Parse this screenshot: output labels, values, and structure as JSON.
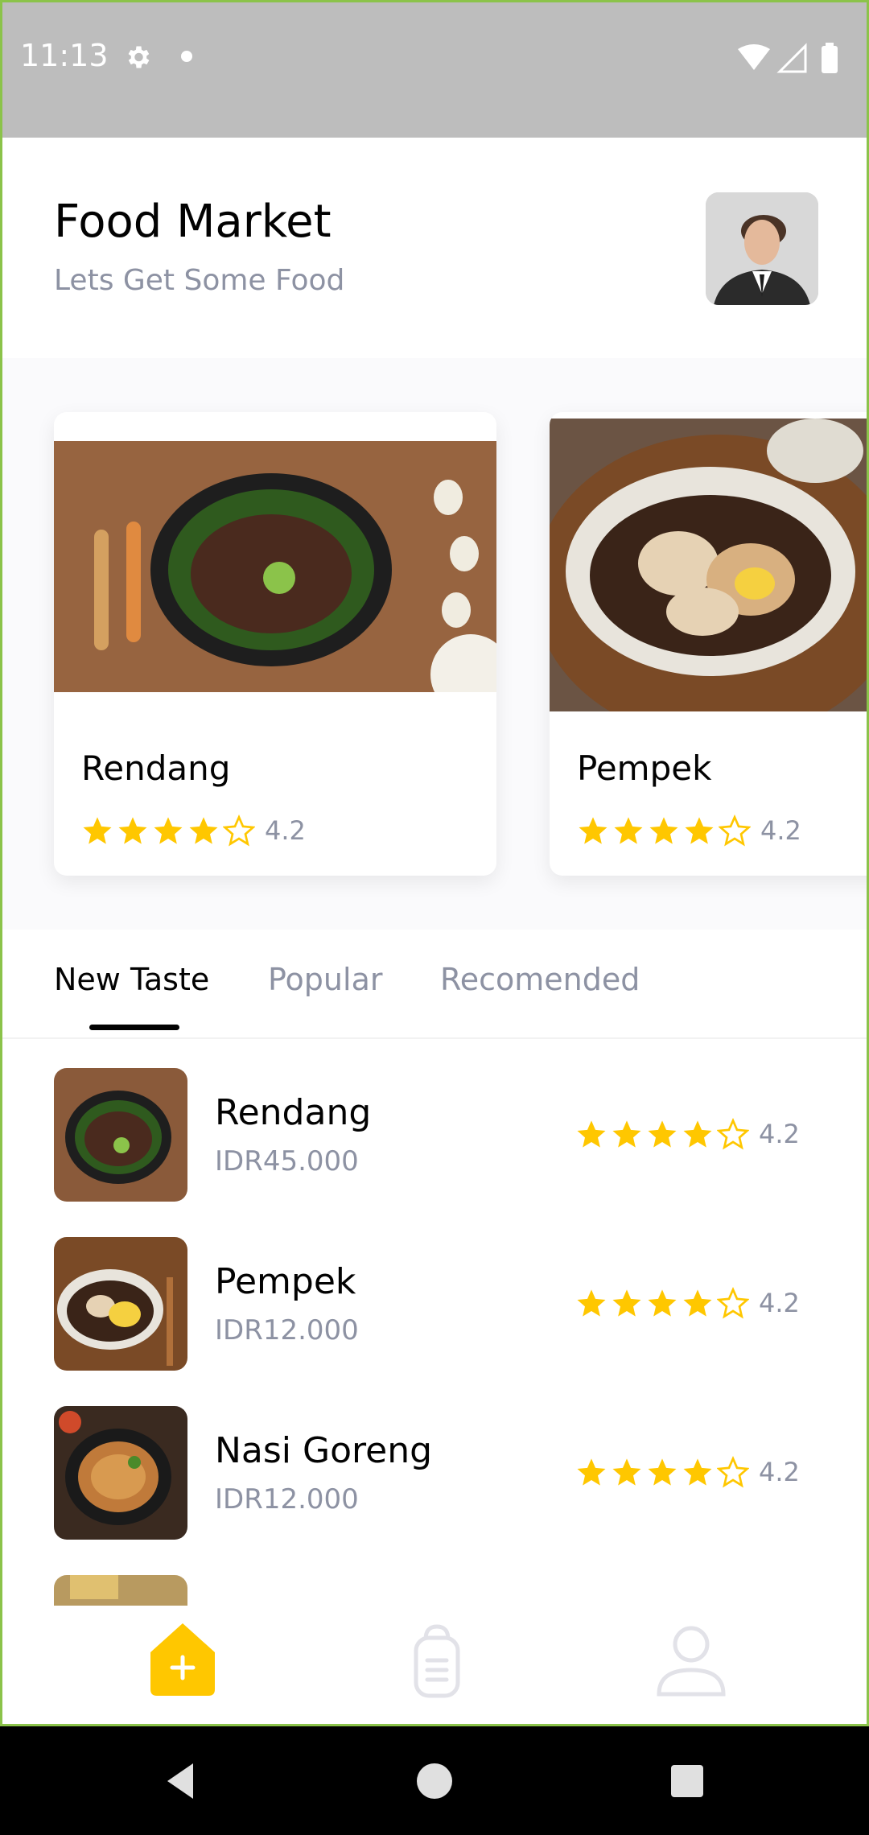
{
  "status_bar": {
    "time": "11:13"
  },
  "header": {
    "title": "Food Market",
    "subtitle": "Lets Get Some Food"
  },
  "featured": [
    {
      "name": "Rendang",
      "rating": "4.2"
    },
    {
      "name": "Pempek",
      "rating": "4.2"
    }
  ],
  "tabs": [
    "New Taste",
    "Popular",
    "Recomended"
  ],
  "active_tab": "New Taste",
  "list": [
    {
      "name": "Rendang",
      "price": "IDR45.000",
      "rating": "4.2"
    },
    {
      "name": "Pempek",
      "price": "IDR12.000",
      "rating": "4.2"
    },
    {
      "name": "Nasi Goreng",
      "price": "IDR12.000",
      "rating": "4.2"
    }
  ],
  "rating_stars": {
    "filled": 4,
    "total": 5
  },
  "colors": {
    "accent": "#ffc700",
    "text_primary": "#020202",
    "text_secondary": "#8d92a3",
    "frame": "#8bc34a"
  },
  "bottom_nav": [
    {
      "icon": "home-icon",
      "active": true
    },
    {
      "icon": "order-bag-icon",
      "active": false
    },
    {
      "icon": "profile-icon",
      "active": false
    }
  ]
}
